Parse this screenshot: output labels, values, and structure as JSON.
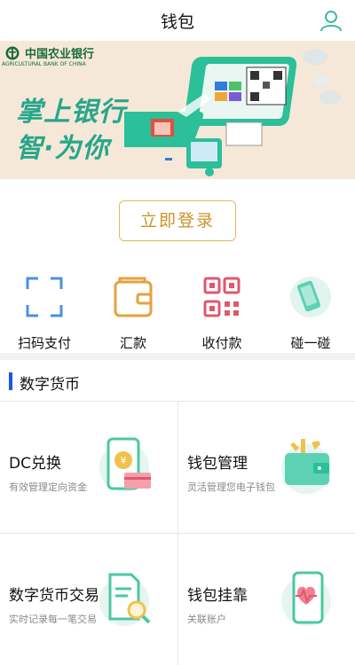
{
  "header": {
    "title": "钱包",
    "user_icon": "user-icon"
  },
  "banner": {
    "bank_name": "中国农业银行",
    "bank_name_en": "AGRICULTURAL BANK OF CHINA",
    "slogan_line1": "掌上银行",
    "slogan_line2": "智·为你",
    "accent_color": "#27a68a"
  },
  "login": {
    "label": "立即登录",
    "color": "#c9932a"
  },
  "services": [
    {
      "label": "扫码支付",
      "icon": "scan-icon"
    },
    {
      "label": "汇款",
      "icon": "wallet-icon"
    },
    {
      "label": "收付款",
      "icon": "qrcode-icon"
    },
    {
      "label": "碰一碰",
      "icon": "phone-tap-icon"
    }
  ],
  "digital_currency": {
    "title": "数字货币",
    "cards": [
      {
        "title": "DC兑换",
        "subtitle": "有效管理定向资金",
        "icon": "exchange-phone-icon"
      },
      {
        "title": "钱包管理",
        "subtitle": "灵活管理您电子钱包",
        "icon": "wallet-tools-icon"
      },
      {
        "title": "数字货币交易",
        "subtitle": "实时记录每一笔交易",
        "icon": "document-search-icon"
      },
      {
        "title": "钱包挂靠",
        "subtitle": "关联账户",
        "icon": "heart-phone-icon"
      }
    ]
  }
}
